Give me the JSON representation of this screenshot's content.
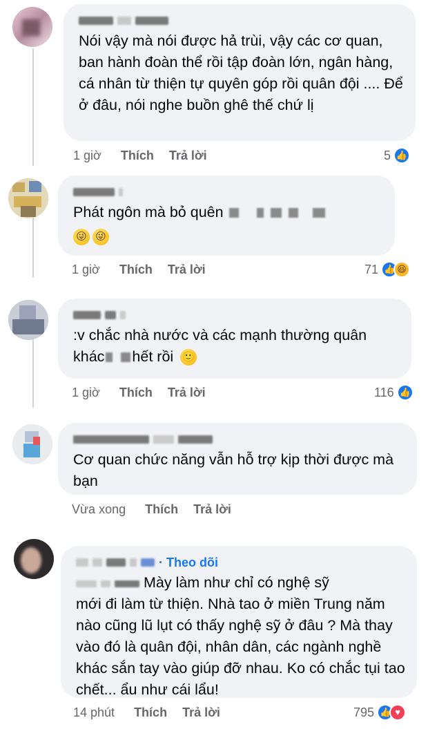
{
  "comments": [
    {
      "text": "Nói vậy mà nói được hả trùi, vậy các cơ quan, ban hành đoàn thể rồi tập đoàn lớn, ngân hàng, cá nhân từ thiện tự quyên góp rồi quân đội .... Để ở đâu, nói nghe buồn ghê thế chứ lị",
      "time": "1 giờ",
      "like_label": "Thích",
      "reply_label": "Trả lời",
      "reaction_count": "5",
      "reactions": [
        "like-icon"
      ]
    },
    {
      "text": "Phát ngôn mà bỏ quên",
      "time": "1 giờ",
      "like_label": "Thích",
      "reply_label": "Trả lời",
      "reaction_count": "71",
      "reactions": [
        "like-icon",
        "haha-icon"
      ]
    },
    {
      "text_line1": ":v chắc nhà nước và các mạnh thường quân",
      "text_line2_a": "khác",
      "text_line2_b": "hết rồi",
      "time": "1 giờ",
      "like_label": "Thích",
      "reply_label": "Trả lời",
      "reaction_count": "116",
      "reactions": [
        "like-icon"
      ]
    },
    {
      "text": "Cơ quan chức năng vẫn hỗ trợ kịp thời được mà bạn",
      "time": "Vừa xong",
      "like_label": "Thích",
      "reply_label": "Trả lời"
    },
    {
      "follow_label": "· Theo dõi",
      "text_line1": "Mày làm như chỉ có nghệ sỹ",
      "text_rest": "mới đi làm từ thiện. Nhà tao ở miền Trung năm nào cũng lũ lụt có thấy nghệ sỹ ở đâu ? Mà thay vào đó là quân đội, nhân dân, các ngành nghề khác sắn tay vào giúp đỡ nhau. Ko có chắc tụi tao chết... ẩu như cái lẩu!",
      "time": "14 phút",
      "like_label": "Thích",
      "reply_label": "Trả lời",
      "reaction_count": "795",
      "reactions": [
        "like-icon",
        "love-icon"
      ]
    }
  ],
  "colors": {
    "bubble": "#f0f2f5",
    "secondary_text": "#65676b",
    "link_blue": "#1877f2",
    "like_blue": "#1877f2",
    "love_red": "#f33e58",
    "haha_yellow": "#f7b928"
  }
}
